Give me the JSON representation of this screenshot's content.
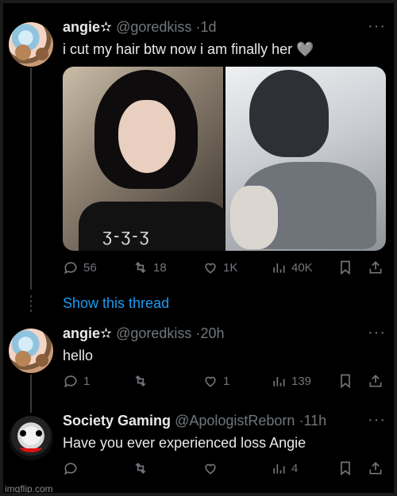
{
  "tweets": [
    {
      "name": "angie✫",
      "handle": "@goredkiss",
      "time": "1d",
      "text": "i cut my hair btw now i am finally her 🩶",
      "reply_count": "56",
      "retweet_count": "18",
      "like_count": "1K",
      "view_count": "40K"
    },
    {
      "name": "angie✫",
      "handle": "@goredkiss",
      "time": "20h",
      "text": "hello",
      "reply_count": "1",
      "retweet_count": "",
      "like_count": "1",
      "view_count": "139"
    },
    {
      "name": "Society Gaming",
      "handle": "@ApologistReborn",
      "time": "11h",
      "text": "Have you ever experienced loss Angie",
      "reply_count": "",
      "retweet_count": "",
      "like_count": "",
      "view_count": "4"
    }
  ],
  "show_thread_label": "Show this thread",
  "media_text": "ʒ-ʒ-ʒ",
  "separator": "·",
  "more_label": "···",
  "watermark": "imgflip.com",
  "colors": {
    "background": "#000000",
    "text": "#e7e9ea",
    "muted": "#71767b",
    "link": "#1d9bf0"
  },
  "icons": [
    "reply-icon",
    "retweet-icon",
    "like-icon",
    "views-icon",
    "bookmark-icon",
    "share-icon",
    "more-icon"
  ]
}
